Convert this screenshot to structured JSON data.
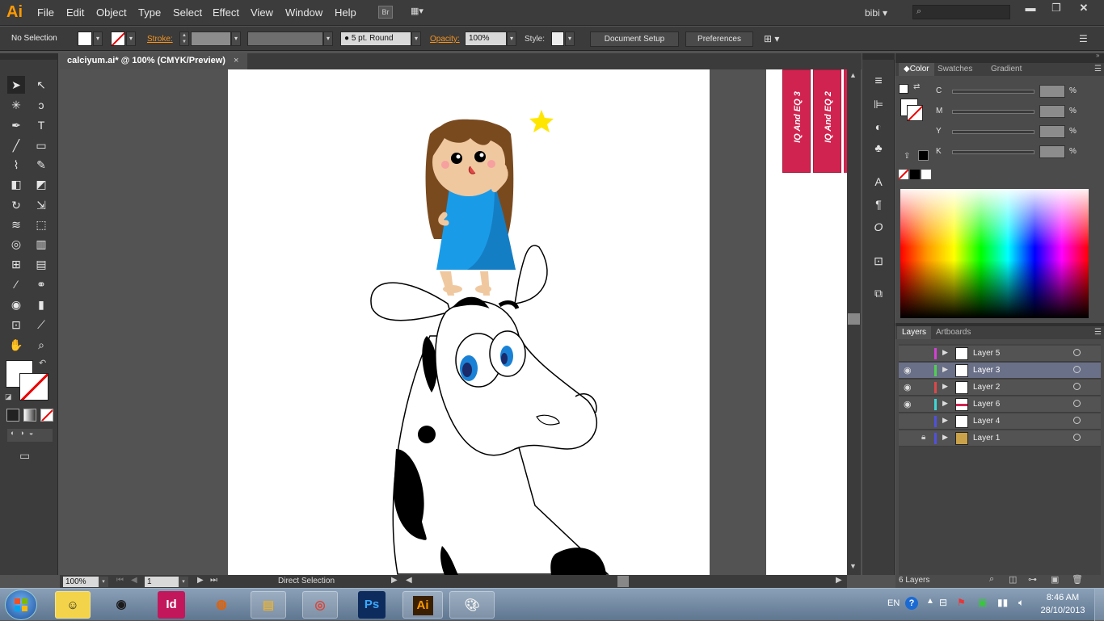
{
  "app": {
    "logo": "Ai",
    "menu": [
      "File",
      "Edit",
      "Object",
      "Type",
      "Select",
      "Effect",
      "View",
      "Window",
      "Help"
    ],
    "bridge": "Br",
    "workspace": "bibi",
    "search_placeholder": ""
  },
  "control": {
    "selection": "No Selection",
    "stroke_label": "Stroke:",
    "brush": "5 pt. Round",
    "opacity_label": "Opacity:",
    "opacity_value": "100%",
    "style_label": "Style:",
    "document_setup": "Document Setup",
    "preferences": "Preferences"
  },
  "document": {
    "tab_title": "calciyum.ai* @ 100% (CMYK/Preview)",
    "close": "×"
  },
  "status": {
    "zoom": "100%",
    "artboard_num": "1",
    "tool": "Direct Selection"
  },
  "banners": [
    "IQ And EQ 3",
    "IQ And EQ 2"
  ],
  "color_panel": {
    "tabs": [
      "Color",
      "Swatches",
      "Gradient"
    ],
    "channels": [
      "C",
      "M",
      "Y",
      "K"
    ],
    "percent": "%"
  },
  "layers_panel": {
    "tabs": [
      "Layers",
      "Artboards"
    ],
    "count": "6 Layers",
    "layers": [
      {
        "name": "Layer 5",
        "color": "#d63fd6",
        "visible": false,
        "locked": false,
        "selected": false
      },
      {
        "name": "Layer 3",
        "color": "#4fd24f",
        "visible": true,
        "locked": false,
        "selected": true
      },
      {
        "name": "Layer 2",
        "color": "#e04848",
        "visible": true,
        "locked": false,
        "selected": false
      },
      {
        "name": "Layer 6",
        "color": "#3fd6d6",
        "visible": true,
        "locked": false,
        "selected": false
      },
      {
        "name": "Layer 4",
        "color": "#5050e0",
        "visible": false,
        "locked": false,
        "selected": false
      },
      {
        "name": "Layer 1",
        "color": "#5050e0",
        "visible": false,
        "locked": true,
        "selected": false
      }
    ]
  },
  "taskbar": {
    "apps": [
      "Id",
      "Ps",
      "Ai"
    ],
    "lang": "EN",
    "time": "8:46 AM",
    "date": "28/10/2013"
  },
  "colors": {
    "accent": "#ff9a00",
    "banner": "#d1234f",
    "dress": "#1a9be8",
    "star": "#ffe600",
    "hair": "#7a4a1f"
  }
}
